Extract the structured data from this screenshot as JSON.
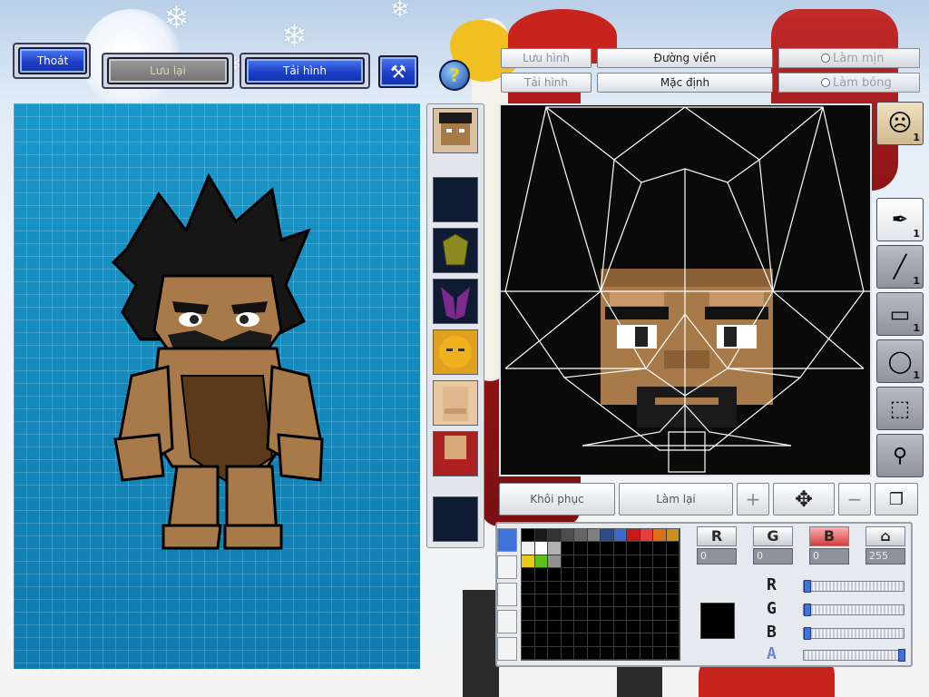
{
  "toolbar": {
    "exit_label": "Thoát",
    "save_label": "Lưu lại",
    "reload_label": "Tải hình"
  },
  "editor": {
    "save_image_label": "Lưu hình",
    "load_image_label": "Tải hình",
    "outline_label": "Đường viền",
    "default_label": "Mặc định",
    "smooth_label": "Làm mịn",
    "gloss_label": "Làm bóng"
  },
  "actions": {
    "restore_label": "Khôi phục",
    "redo_label": "Làm lại"
  },
  "tools": {
    "head_badge": "1",
    "pen_badge": "1",
    "line_badge": "1",
    "rect_badge": "1",
    "ellipse_badge": "1"
  },
  "color": {
    "r_label": "R",
    "g_label": "G",
    "b_label": "B",
    "r_value": "0",
    "g_value": "0",
    "b_value": "0",
    "a_value": "255",
    "current": "#000000",
    "slider_r": 0,
    "slider_g": 0,
    "slider_b": 0,
    "slider_a": 1,
    "swatches_row1": [
      "#000000",
      "#1a1a1a",
      "#333333",
      "#4d4d4d",
      "#666666",
      "#808080",
      "#2a4a8a",
      "#3a6acc",
      "#c81818",
      "#e04040",
      "#e07018",
      "#c89020"
    ],
    "swatches_row2": [
      "#f0f0f0",
      "#ffffff",
      "#b0b0b0",
      "#000000",
      "#000000",
      "#000000",
      "#000000",
      "#000000",
      "#000000",
      "#000000",
      "#000000",
      "#000000"
    ],
    "swatches_row3": [
      "#e8c818",
      "#60c020",
      "#909090",
      "#000000",
      "#000000",
      "#000000",
      "#000000",
      "#000000",
      "#000000",
      "#000000",
      "#000000",
      "#000000"
    ]
  }
}
